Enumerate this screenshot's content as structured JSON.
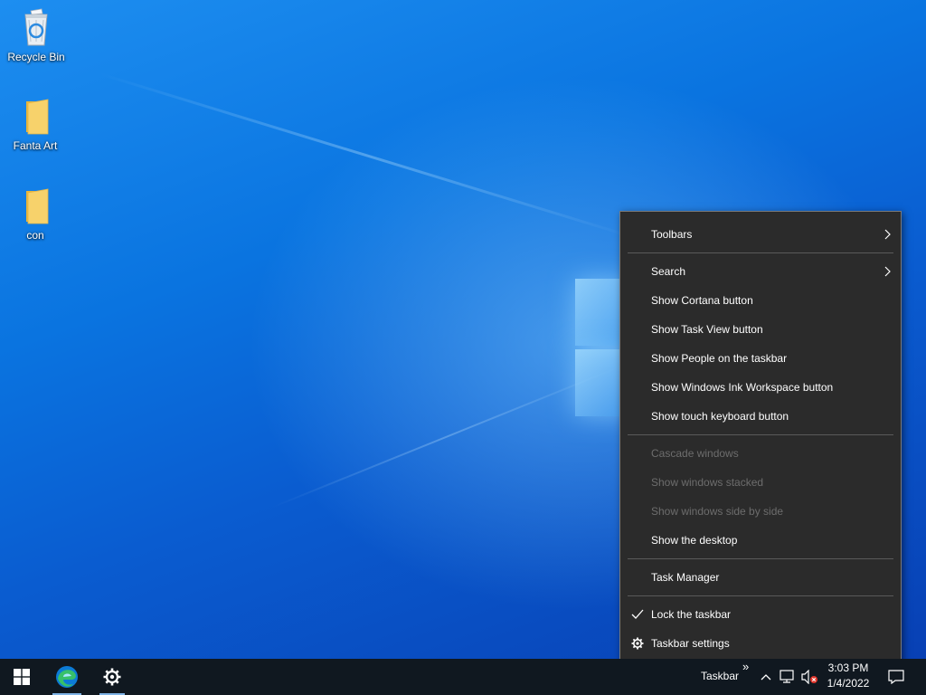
{
  "desktop": {
    "icons": [
      {
        "label": "Recycle Bin",
        "icon": "recycle-bin-icon"
      },
      {
        "label": "Fanta Art",
        "icon": "folder-icon"
      },
      {
        "label": "con",
        "icon": "folder-icon"
      }
    ]
  },
  "context_menu": {
    "items": [
      {
        "label": "Toolbars",
        "submenu": true,
        "enabled": true
      },
      {
        "label": "Search",
        "submenu": true,
        "enabled": true
      },
      {
        "label": "Show Cortana button",
        "enabled": true
      },
      {
        "label": "Show Task View button",
        "enabled": true
      },
      {
        "label": "Show People on the taskbar",
        "enabled": true
      },
      {
        "label": "Show Windows Ink Workspace button",
        "enabled": true
      },
      {
        "label": "Show touch keyboard button",
        "enabled": true
      },
      {
        "label": "Cascade windows",
        "enabled": false
      },
      {
        "label": "Show windows stacked",
        "enabled": false
      },
      {
        "label": "Show windows side by side",
        "enabled": false
      },
      {
        "label": "Show the desktop",
        "enabled": true
      },
      {
        "label": "Task Manager",
        "enabled": true
      },
      {
        "label": "Lock the taskbar",
        "checked": true,
        "enabled": true
      },
      {
        "label": "Taskbar settings",
        "icon": "gear-icon",
        "enabled": true
      }
    ]
  },
  "taskbar": {
    "apps": [
      {
        "name": "Microsoft Edge",
        "icon": "edge-icon"
      },
      {
        "name": "Settings",
        "icon": "gear-icon"
      }
    ],
    "toolbar_label": "Taskbar",
    "overflow_glyph": "»",
    "clock": {
      "time": "3:03 PM",
      "date": "1/4/2022"
    },
    "colors": {
      "background": "#101820",
      "menu_background": "#2b2b2b",
      "accent": "#7fb3e6"
    }
  }
}
